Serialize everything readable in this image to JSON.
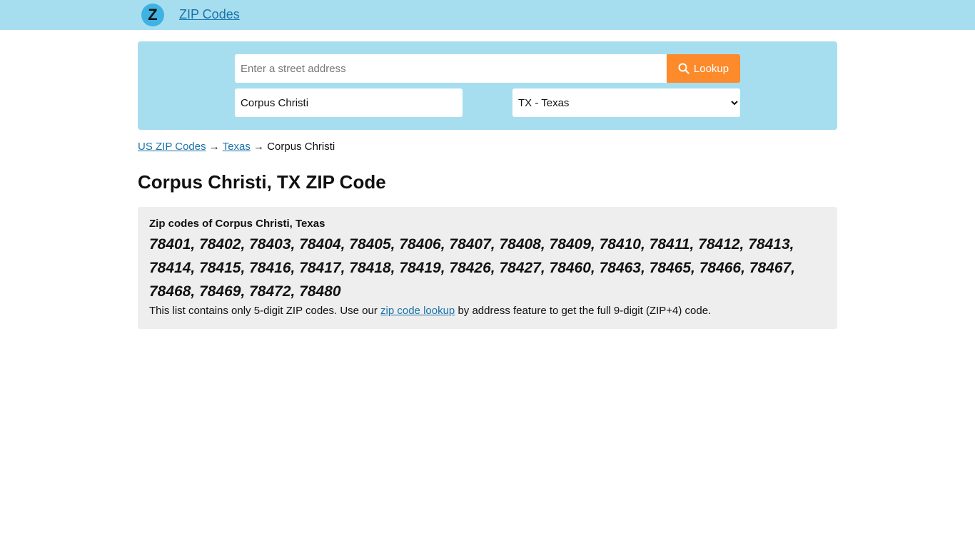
{
  "header": {
    "logo_letter": "Z",
    "site_name": "ZIP Codes"
  },
  "search": {
    "address_placeholder": "Enter a street address",
    "lookup_label": "Lookup",
    "city_value": "Corpus Christi",
    "state_selected": "TX - Texas"
  },
  "breadcrumb": {
    "items": [
      "US ZIP Codes",
      "Texas",
      "Corpus Christi"
    ],
    "separator": "→"
  },
  "page": {
    "title": "Corpus Christi, TX ZIP Code"
  },
  "zip_section": {
    "heading": "Zip codes of Corpus Christi, Texas",
    "codes": "78401, 78402, 78403, 78404, 78405, 78406, 78407, 78408, 78409, 78410, 78411, 78412, 78413, 78414, 78415, 78416, 78417, 78418, 78419, 78426, 78427, 78460, 78463, 78465, 78466, 78467, 78468, 78469, 78472, 78480",
    "note_before": "This list contains only 5-digit ZIP codes. Use our ",
    "note_link": "zip code lookup",
    "note_after": " by address feature to get the full 9-digit (ZIP+4) code."
  },
  "colors": {
    "header_bg": "#a6def0",
    "accent_button": "#fd8a2b",
    "link": "#1a73a8"
  }
}
